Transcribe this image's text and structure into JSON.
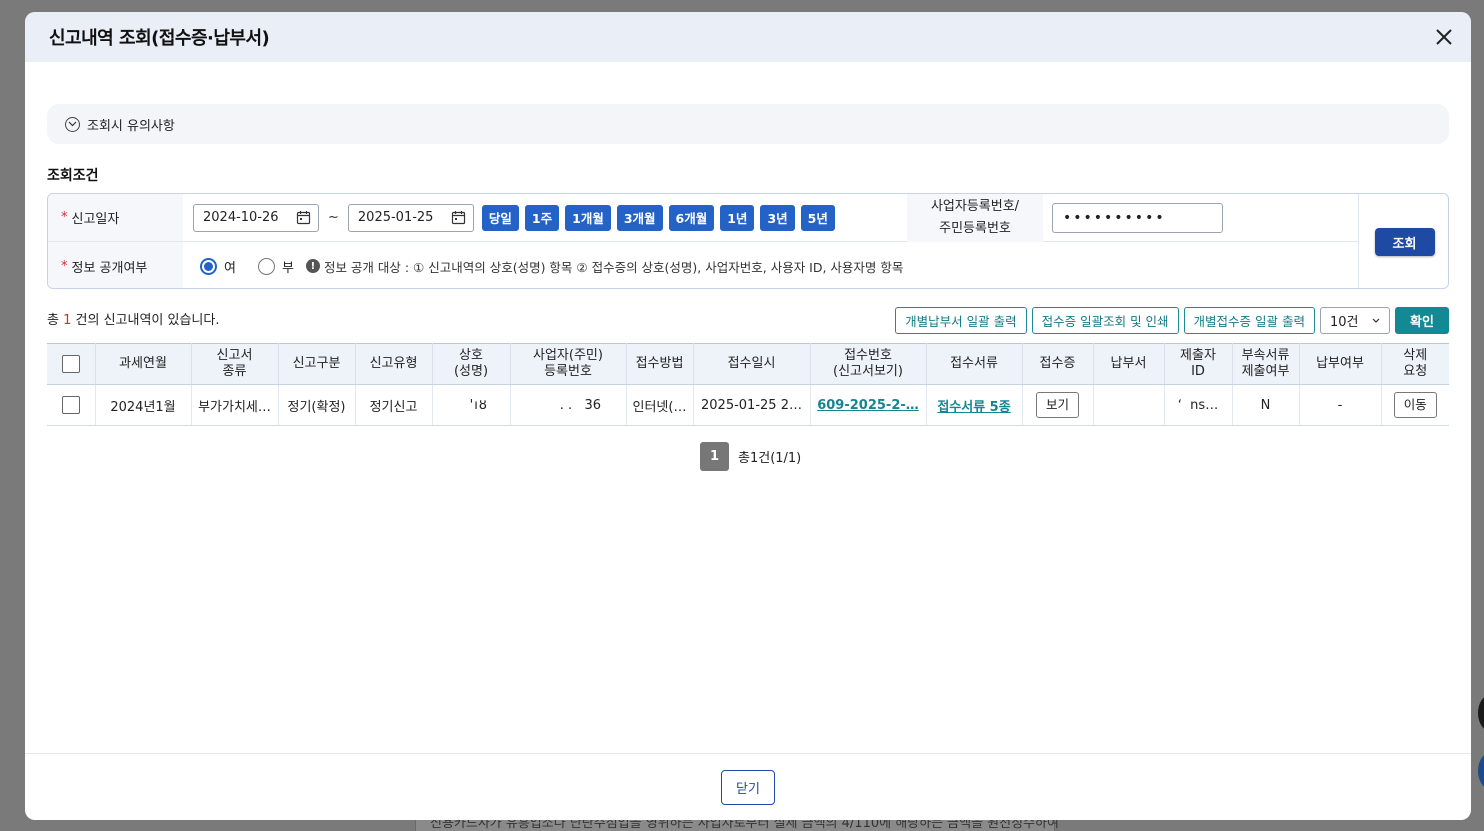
{
  "backdrop": {
    "text": "신용카드사가 유흥업소나 단란주점업을 영위하는 사업자로부터 실제 금액의 4/110에 해당하는 금액을 원천징수하여"
  },
  "modal": {
    "title": "신고내역 조회(접수증·납부서)"
  },
  "notice": {
    "label": "조회시 유의사항"
  },
  "conditions": {
    "section_title": "조회조건",
    "report_date_label": "신고일자",
    "date_from": "2024-10-26",
    "date_to": "2025-01-25",
    "tilde": "~",
    "period_buttons": [
      "당일",
      "1주",
      "1개월",
      "3개월",
      "6개월",
      "1년",
      "3년",
      "5년"
    ],
    "bizno_label_line1": "사업자등록번호/",
    "bizno_label_line2": "주민등록번호",
    "bizno_value": "••••••••••",
    "disclosure_label": "정보 공개여부",
    "radio_yes": "여",
    "radio_no": "부",
    "radio_selected": "여",
    "info_note": "정보 공개 대상 : ① 신고내역의 상호(성명) 항목 ② 접수증의 상호(성명), 사업자번호, 사용자 ID, 사용자명 항목",
    "search_button": "조회"
  },
  "results": {
    "count_prefix": "총",
    "count": "1",
    "count_suffix": "건의 신고내역이 있습니다.",
    "toolbar": {
      "btn_individual_payment": "개별납부서 일괄 출력",
      "btn_receipt_batch": "접수증 일괄조회 및 인쇄",
      "btn_individual_receipt": "개별접수증 일괄 출력",
      "page_size": "10건",
      "confirm": "확인"
    },
    "columns": [
      {
        "l1": "",
        "l2": ""
      },
      {
        "l1": "과세연월",
        "l2": ""
      },
      {
        "l1": "신고서",
        "l2": "종류"
      },
      {
        "l1": "신고구분",
        "l2": ""
      },
      {
        "l1": "신고유형",
        "l2": ""
      },
      {
        "l1": "상호",
        "l2": "(성명)"
      },
      {
        "l1": "사업자(주민)",
        "l2": "등록번호"
      },
      {
        "l1": "접수방법",
        "l2": ""
      },
      {
        "l1": "접수일시",
        "l2": ""
      },
      {
        "l1": "접수번호",
        "l2": "(신고서보기)"
      },
      {
        "l1": "접수서류",
        "l2": ""
      },
      {
        "l1": "접수증",
        "l2": ""
      },
      {
        "l1": "납부서",
        "l2": ""
      },
      {
        "l1": "제출자",
        "l2": "ID"
      },
      {
        "l1": "부속서류",
        "l2": "제출여부"
      },
      {
        "l1": "납부여부",
        "l2": ""
      },
      {
        "l1": "삭제",
        "l2": "요청"
      }
    ],
    "rows": [
      {
        "tax_period": "2024년1월",
        "form_type": "부가가치세…",
        "report_class": "정기(확정)",
        "report_type": "정기신고",
        "name": "   'ıȣ",
        "reg_no": "      . .   36",
        "method": "인터넷(…",
        "received_at": "2025-01-25 2…",
        "receipt_no": "609-2025-2-…",
        "documents": "접수서류 5종",
        "receipt_btn": "보기",
        "payment": "",
        "submitter_id": "ʻ  ns…",
        "attachments": "N",
        "paid": "-",
        "delete_btn": "이동"
      }
    ]
  },
  "pagination": {
    "current": "1",
    "info": "총1건(1/1)"
  },
  "footer": {
    "close_button": "닫기"
  }
}
